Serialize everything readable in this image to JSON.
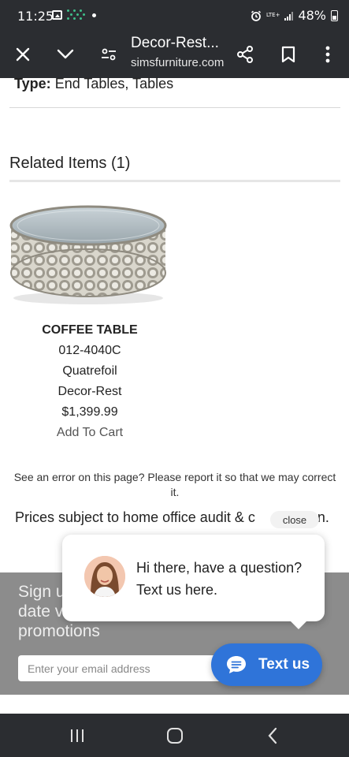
{
  "status_bar": {
    "time": "11:25",
    "network": "LTE+",
    "battery": "48%"
  },
  "toolbar": {
    "title": "Decor-Rest...",
    "url": "simsfurniture.com"
  },
  "page": {
    "type_label": "Type:",
    "type_value": "End Tables, Tables",
    "related_title": "Related Items (1)",
    "product": {
      "name": "COFFEE TABLE",
      "sku": "012-4040C",
      "collection": "Quatrefoil",
      "brand": "Decor-Rest",
      "price": "$1,399.99",
      "cart_label": "Add To Cart"
    },
    "error_note": "See an error on this page? Please report it so that we may correct it.",
    "prices_note": "Prices subject to home office audit & c",
    "prices_note_tail": "n."
  },
  "signup": {
    "text": "Sign u\ndate v\npromotions",
    "email_placeholder": "Enter your email address"
  },
  "chat": {
    "close_label": "close",
    "message": "Hi there, have a question? Text us here.",
    "button_label": "Text us",
    "accent": "#2f74d9"
  }
}
